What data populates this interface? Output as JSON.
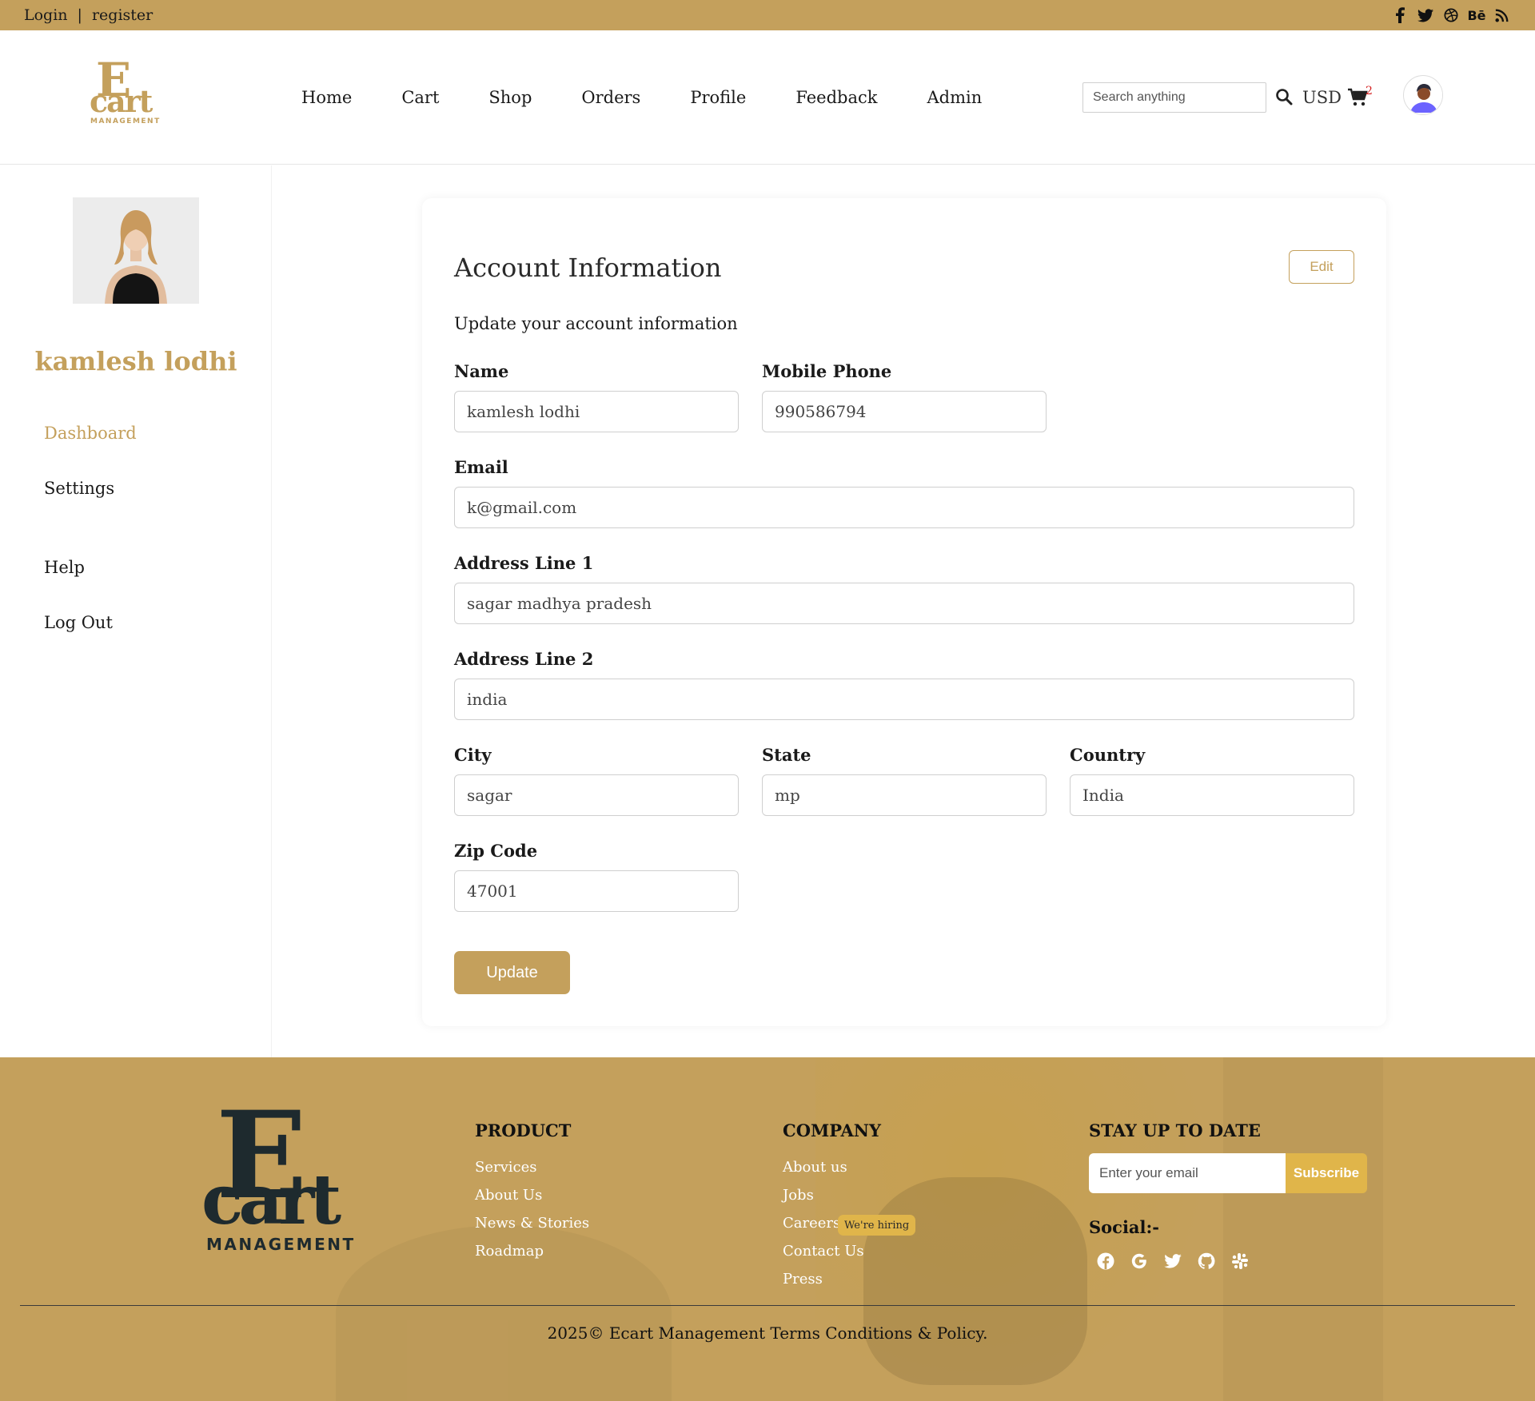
{
  "topbar": {
    "login": "Login",
    "separator": "|",
    "register": "register",
    "social": [
      "facebook-icon",
      "twitter-icon",
      "dribbble-icon",
      "behance-icon",
      "rss-icon"
    ],
    "behance_text": "Bē"
  },
  "brand": {
    "logo_letter": "E",
    "logo_word": "cart",
    "logo_tag": "MANAGEMENT",
    "accent": "#c4a05c",
    "dark": "#1e2a2e"
  },
  "nav": {
    "items": [
      "Home",
      "Cart",
      "Shop",
      "Orders",
      "Profile",
      "Feedback",
      "Admin"
    ]
  },
  "header": {
    "search_placeholder": "Search anything",
    "currency": "USD",
    "cart_count": "2"
  },
  "sidebar": {
    "user_name": "kamlesh lodhi",
    "links": [
      "Dashboard",
      "Settings",
      "Help",
      "Log Out"
    ]
  },
  "account": {
    "title": "Account Information",
    "edit_label": "Edit",
    "subtitle": "Update your account information",
    "fields": {
      "name": {
        "label": "Name",
        "value": "kamlesh lodhi"
      },
      "phone": {
        "label": "Mobile Phone",
        "value": "990586794"
      },
      "email": {
        "label": "Email",
        "value": "k@gmail.com"
      },
      "address1": {
        "label": "Address Line 1",
        "value": "sagar madhya pradesh"
      },
      "address2": {
        "label": "Address Line 2",
        "value": "india"
      },
      "city": {
        "label": "City",
        "value": "sagar"
      },
      "state": {
        "label": "State",
        "value": "mp"
      },
      "country": {
        "label": "Country",
        "value": "India"
      },
      "zip": {
        "label": "Zip Code",
        "value": "47001"
      }
    },
    "update_label": "Update"
  },
  "footer": {
    "product": {
      "title": "PRODUCT",
      "links": [
        "Services",
        "About Us",
        "News & Stories",
        "Roadmap"
      ]
    },
    "company": {
      "title": "COMPANY",
      "links": [
        "About us",
        "Jobs",
        "Careers",
        "Contact Us",
        "Press"
      ],
      "hiring_badge": "We're hiring"
    },
    "newsletter": {
      "title": "STAY UP TO DATE",
      "placeholder": "Enter your email",
      "subscribe_label": "Subscribe",
      "social_label": "Social:-",
      "social_icons": [
        "facebook-icon",
        "google-icon",
        "twitter-icon",
        "github-icon",
        "slack-icon"
      ]
    },
    "copyright": "2025© Ecart Management Terms Conditions & Policy."
  }
}
